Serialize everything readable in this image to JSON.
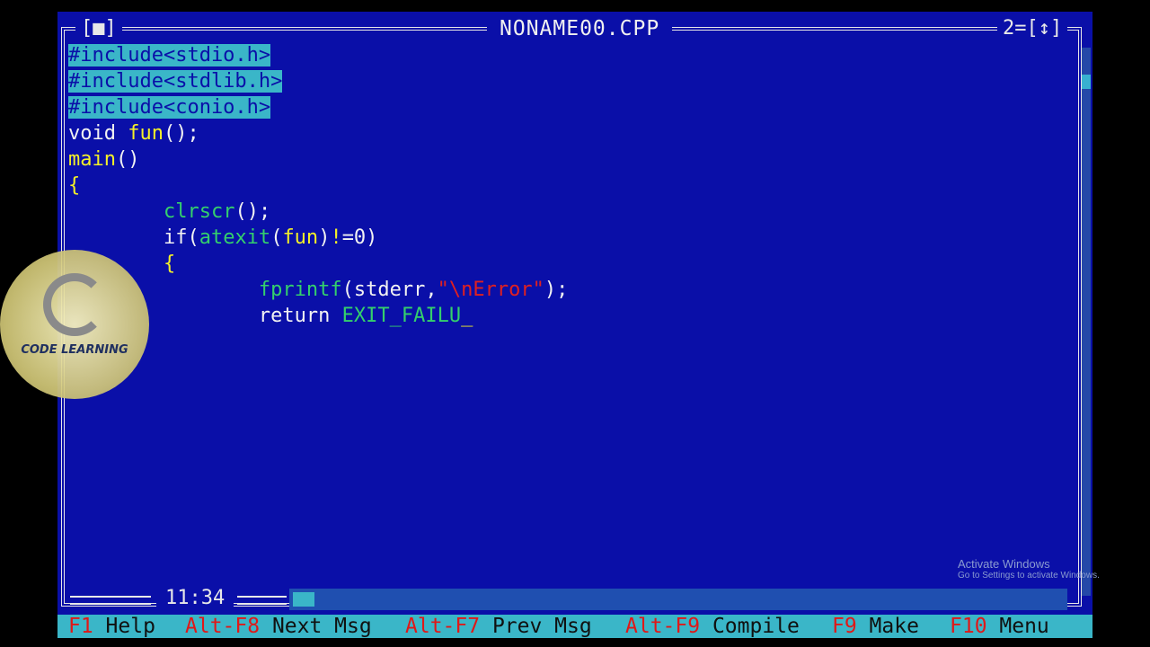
{
  "window": {
    "title": "NONAME00.CPP",
    "close_button": "[■]",
    "zoom_indicator": "2=[↕]"
  },
  "editor": {
    "lines": [
      {
        "segments": [
          {
            "text": "#include<stdio.h>",
            "cls": "sel"
          }
        ]
      },
      {
        "segments": [
          {
            "text": "#include<stdlib.h>",
            "cls": "sel"
          }
        ]
      },
      {
        "segments": [
          {
            "text": "#include<conio.h>",
            "cls": "sel"
          }
        ]
      },
      {
        "segments": [
          {
            "text": "void ",
            "cls": "kw"
          },
          {
            "text": "fun",
            "cls": "ident"
          },
          {
            "text": "();",
            "cls": "kw"
          }
        ]
      },
      {
        "segments": [
          {
            "text": "main",
            "cls": "ident"
          },
          {
            "text": "()",
            "cls": "kw"
          }
        ]
      },
      {
        "segments": [
          {
            "text": "{",
            "cls": "ident"
          }
        ]
      },
      {
        "segments": [
          {
            "text": "        ",
            "cls": "kw"
          },
          {
            "text": "clrscr",
            "cls": "fn"
          },
          {
            "text": "();",
            "cls": "kw"
          }
        ]
      },
      {
        "segments": [
          {
            "text": "        if(",
            "cls": "kw"
          },
          {
            "text": "atexit",
            "cls": "fn"
          },
          {
            "text": "(",
            "cls": "kw"
          },
          {
            "text": "fun",
            "cls": "ident"
          },
          {
            "text": ")",
            "cls": "kw"
          },
          {
            "text": "!",
            "cls": "ident"
          },
          {
            "text": "=0)",
            "cls": "kw"
          }
        ]
      },
      {
        "segments": [
          {
            "text": "        ",
            "cls": "kw"
          },
          {
            "text": "{",
            "cls": "ident"
          }
        ]
      },
      {
        "segments": [
          {
            "text": "                ",
            "cls": "kw"
          },
          {
            "text": "fprintf",
            "cls": "fn"
          },
          {
            "text": "(stderr,",
            "cls": "kw"
          },
          {
            "text": "\"\\nError\"",
            "cls": "str"
          },
          {
            "text": ");",
            "cls": "kw"
          }
        ]
      },
      {
        "segments": [
          {
            "text": "                return ",
            "cls": "kw"
          },
          {
            "text": "EXIT_FAILU",
            "cls": "fn"
          },
          {
            "text": "_",
            "cls": "cursor"
          }
        ]
      }
    ]
  },
  "status": {
    "cursor_position": "11:34"
  },
  "function_keys": [
    {
      "key": "F1",
      "label": "Help"
    },
    {
      "key": "Alt-F8",
      "label": "Next Msg"
    },
    {
      "key": "Alt-F7",
      "label": "Prev Msg"
    },
    {
      "key": "Alt-F9",
      "label": "Compile"
    },
    {
      "key": "F9",
      "label": "Make"
    },
    {
      "key": "F10",
      "label": "Menu"
    }
  ],
  "watermark": {
    "text": "CODE LEARNING"
  },
  "os_notice": {
    "title": "Activate Windows",
    "subtitle": "Go to Settings to activate Windows."
  },
  "colors": {
    "editor_background": "#0A0FA8",
    "selection": "#3AB6C8",
    "keyword": "#F2F2F2",
    "identifier": "#F4F028",
    "function": "#34D06C",
    "string": "#E02020",
    "function_key": "#E01818"
  }
}
